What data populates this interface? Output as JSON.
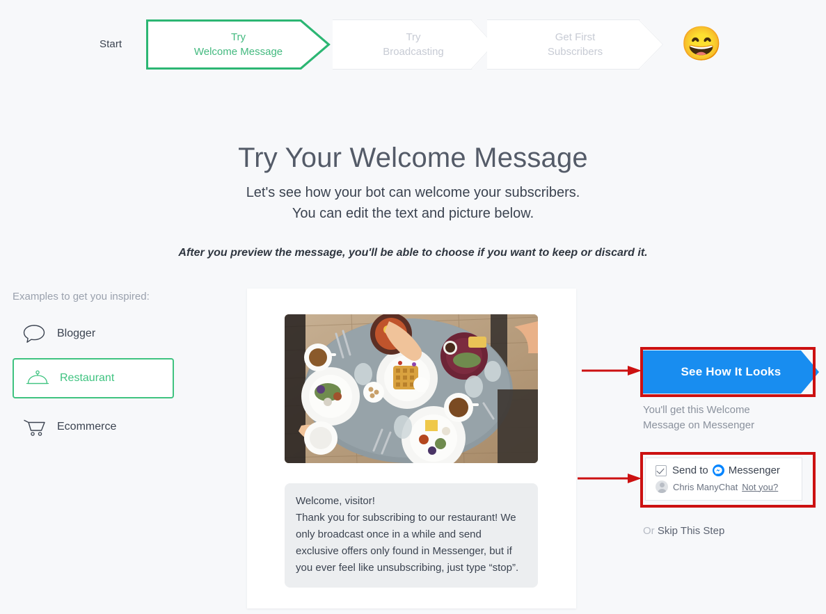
{
  "breadcrumb": {
    "start_label": "Start",
    "steps": [
      {
        "line1": "Try",
        "line2": "Welcome Message",
        "text": "Try\nWelcome Message",
        "state": "active"
      },
      {
        "line1": "Try",
        "line2": "Broadcasting",
        "text": "Try\nBroadcasting",
        "state": "inactive"
      },
      {
        "line1": "Get First",
        "line2": "Subscribers",
        "text": "Get First\nSubscribers",
        "state": "inactive"
      }
    ],
    "finish_emoji": "😄"
  },
  "heading": {
    "title": "Try Your Welcome Message",
    "subtitle": "Let's see how your bot can welcome your subscribers.\nYou can edit the text and picture below.",
    "note": "After you preview the message, you'll be able to choose if you want to keep or discard it."
  },
  "examples": {
    "label": "Examples to get you inspired:",
    "items": [
      {
        "label": "Blogger",
        "icon": "speech-bubble-icon",
        "selected": false
      },
      {
        "label": "Restaurant",
        "icon": "food-dome-icon",
        "selected": true
      },
      {
        "label": "Ecommerce",
        "icon": "shopping-cart-icon",
        "selected": false
      }
    ]
  },
  "preview": {
    "image_alt": "breakfast-table-photo",
    "message": "Welcome, visitor!\nThank you for subscribing to our restaurant! We only broadcast once in a while and send exclusive offers only found in Messenger, but if you ever feel like unsubscribing, just type “stop”."
  },
  "actions": {
    "cta_label": "See How It Looks",
    "cta_caption": "You'll get this Welcome\nMessage on Messenger",
    "send_to_prefix": "Send to",
    "send_to_channel": "Messenger",
    "account_name": "Chris ManyChat",
    "not_you_label": "Not you?",
    "skip_prefix": "Or",
    "skip_label": "Skip This Step"
  },
  "colors": {
    "accent_green": "#3fc380",
    "step_active_green": "#2cb673",
    "messenger_blue": "#0084ff",
    "cta_blue": "#188df0",
    "annotation_red": "#cc1111",
    "page_background": "#f7f8fa",
    "muted_text": "#9aa1ad"
  }
}
